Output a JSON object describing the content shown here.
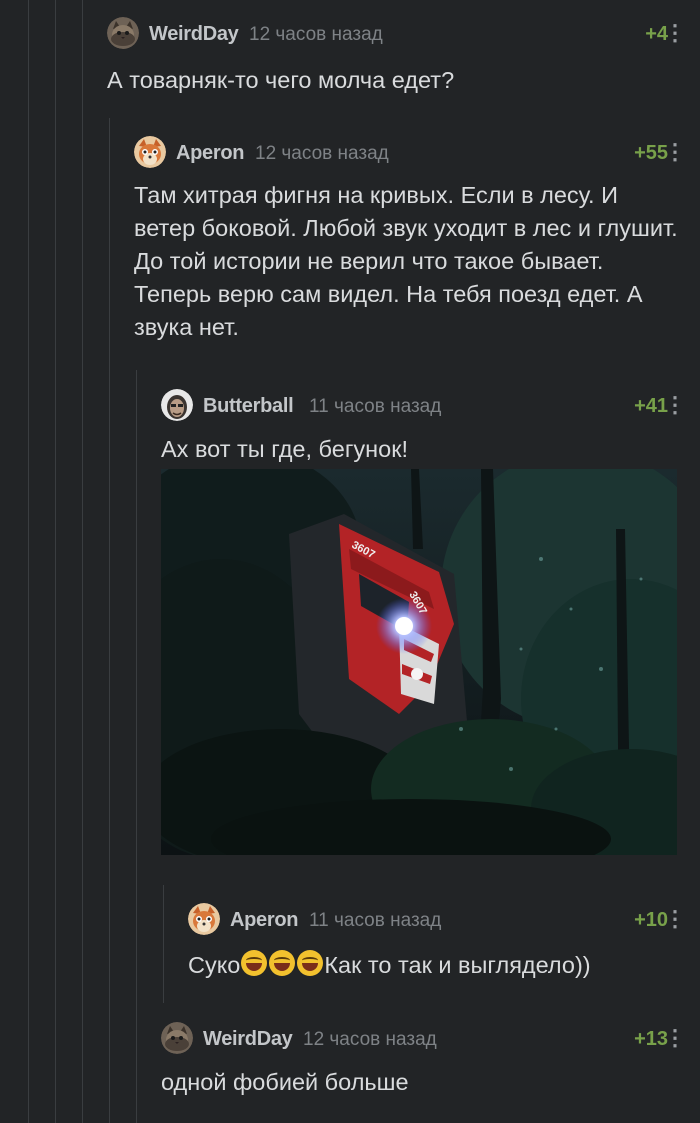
{
  "comments": [
    {
      "author": "WeirdDay",
      "time": "12 часов назад",
      "rating": "+4",
      "text": "А товарняк-то чего молча едет?",
      "avatar": "cat-avatar"
    },
    {
      "author": "Aperon",
      "time": "12 часов назад",
      "rating": "+55",
      "text": "Там хитрая фигня на кривых. Если в лесу. И ветер боковой. Любой звук уходит в лес и глушит. До той истории не верил что такое бывает. Теперь верю сам видел. На тебя поезд едет. А звука нет.",
      "avatar": "fox-avatar"
    },
    {
      "author": "Butterball",
      "time": "11 часов назад",
      "rating": "+41",
      "text": "Ах вот ты где, бегунок!",
      "avatar": "face-avatar",
      "image": {
        "loco_number_1": "3607",
        "loco_number_2": "3607"
      }
    },
    {
      "author": "Aperon",
      "time": "11 часов назад",
      "rating": "+10",
      "text_before": "Суко",
      "text_after": "Как то так и выглядело))",
      "emoji": "face-with-tears-of-joy",
      "avatar": "fox-avatar"
    },
    {
      "author": "WeirdDay",
      "time": "12 часов назад",
      "rating": "+13",
      "text": "одной фобией больше",
      "avatar": "cat-avatar"
    }
  ],
  "more_icon": "⋮",
  "colors": {
    "background": "#222426",
    "rating": "#78a14a",
    "text": "#d9dbdd",
    "muted": "#7e8286"
  }
}
